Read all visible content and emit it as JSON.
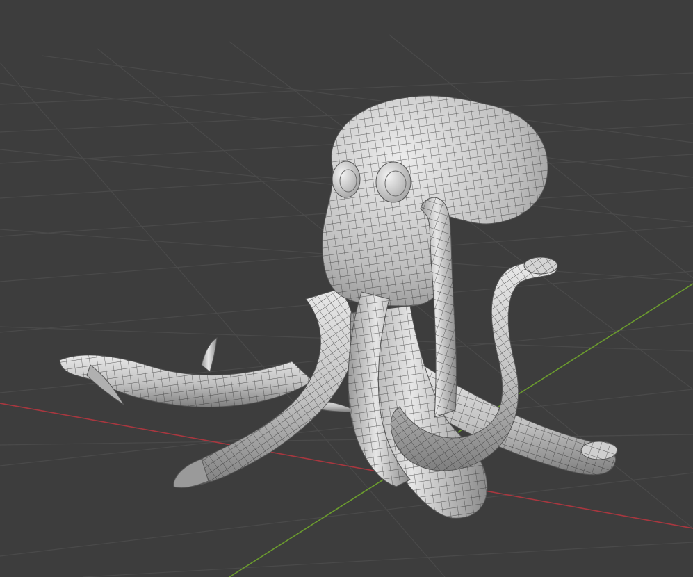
{
  "viewport": {
    "mode": "3D Viewport",
    "shading": "solid",
    "overlays": {
      "grid_floor": true,
      "x_axis": true,
      "y_axis": true,
      "wireframe": true
    },
    "object_icon": "octopus-mesh-icon"
  },
  "colors": {
    "background": "#3d3d3d",
    "grid": "#4a4a4a",
    "x_axis": "#a8373f",
    "y_axis": "#6b9b2e",
    "mesh_fill_light": "#e4e4e4",
    "mesh_fill_mid": "#b9b9b9",
    "mesh_fill_dark": "#7d7d7d",
    "wire": "#2f2f2f"
  }
}
